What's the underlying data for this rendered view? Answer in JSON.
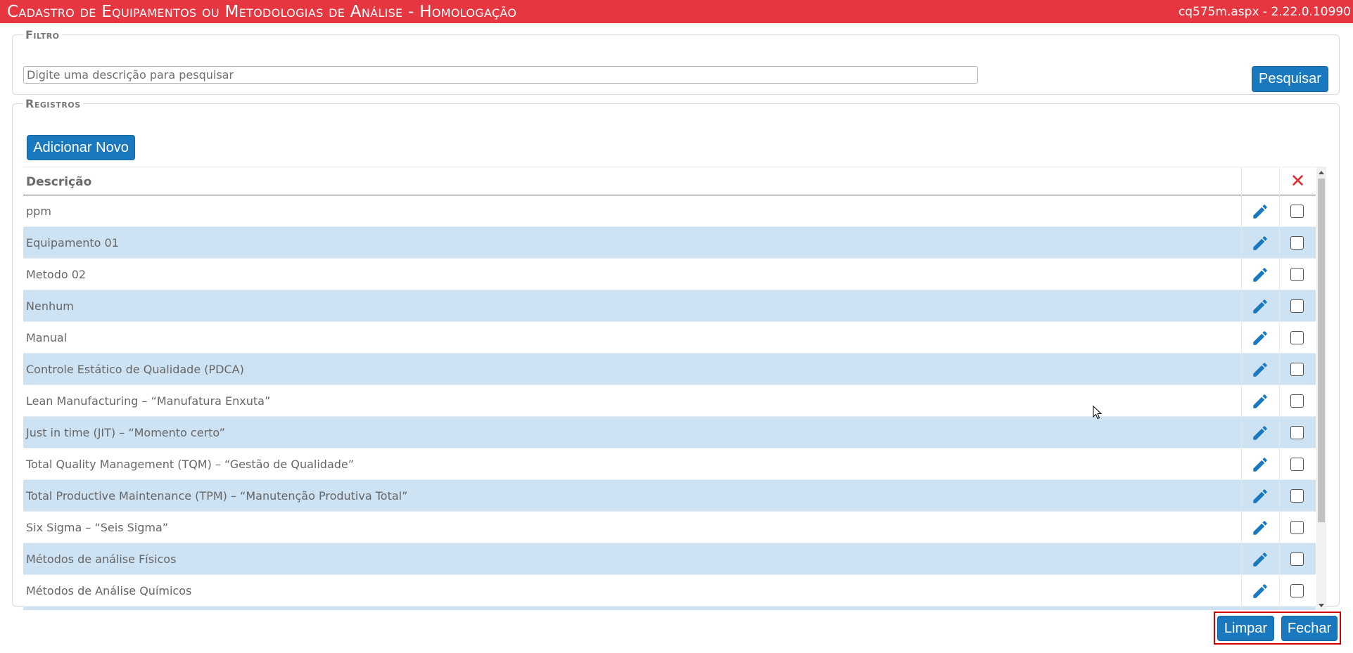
{
  "window": {
    "title": "Cadastro de Equipamentos ou Metodologias de Análise  - Homologação",
    "version": "cq575m.aspx - 2.22.0.10990"
  },
  "filtro": {
    "legend": "Filtro",
    "search_placeholder": "Digite uma descrição para pesquisar",
    "search_value": "",
    "search_button": "Pesquisar"
  },
  "registros": {
    "legend": "Registros",
    "add_button": "Adicionar Novo",
    "columns": {
      "descricao": "Descrição",
      "delete_all_symbol": "✕"
    },
    "rows": [
      {
        "descricao": "ppm"
      },
      {
        "descricao": "Equipamento 01"
      },
      {
        "descricao": "Metodo 02"
      },
      {
        "descricao": "Nenhum"
      },
      {
        "descricao": "Manual"
      },
      {
        "descricao": "Controle Estático de Qualidade (PDCA)"
      },
      {
        "descricao": "Lean Manufacturing – “Manufatura Enxuta”"
      },
      {
        "descricao": "Just in time (JIT) – “Momento certo”"
      },
      {
        "descricao": "Total Quality Management (TQM) – “Gestão de Qualidade”"
      },
      {
        "descricao": "Total Productive Maintenance (TPM) – “Manutenção Produtiva Total”"
      },
      {
        "descricao": "Six Sigma – “Seis Sigma”"
      },
      {
        "descricao": "Métodos de análise Físicos"
      },
      {
        "descricao": "Métodos de Análise Químicos"
      },
      {
        "descricao": ""
      }
    ]
  },
  "footer": {
    "clear_button": "Limpar",
    "close_button": "Fechar"
  },
  "icons": {
    "edit": "pencil-icon",
    "delete": "close-icon",
    "row_select": "checkbox"
  },
  "colors": {
    "title_bar": "#e63640",
    "button": "#1a78bf",
    "row_alt": "#cde2f2",
    "delete_x": "#e02a32",
    "highlight_border": "#d40000"
  }
}
